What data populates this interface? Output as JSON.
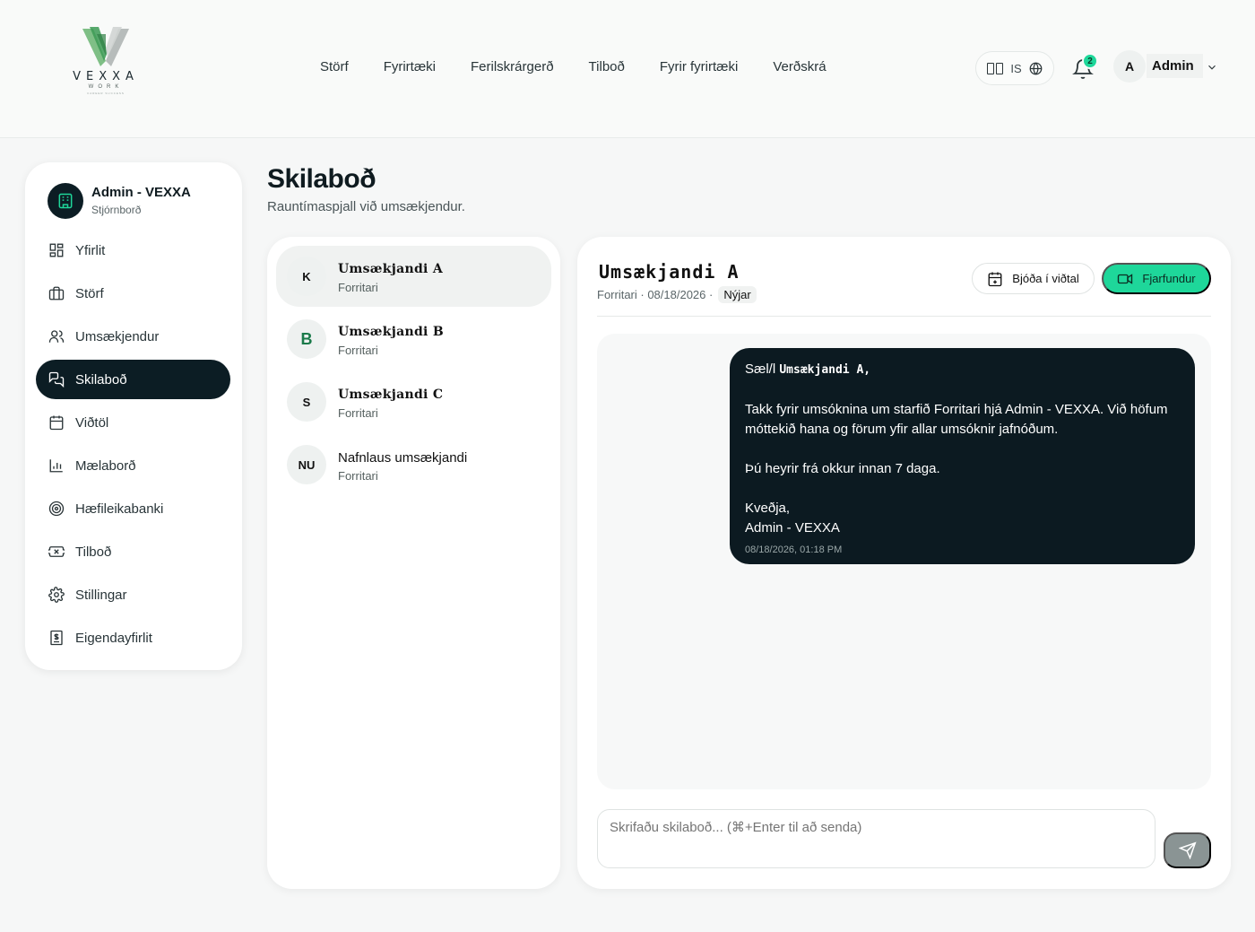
{
  "logo": {
    "brand": "VEXXA",
    "sub": "WORK",
    "tagline": "CAREER SUCCESS"
  },
  "nav": [
    "Störf",
    "Fyrirtæki",
    "Ferilskrárgerð",
    "Tilboð",
    "Fyrir fyrirtæki",
    "Verðskrá"
  ],
  "header": {
    "language": "IS",
    "notification_count": "2",
    "user_initial": "A",
    "user_name": "Admin"
  },
  "sidebar": {
    "title": "Admin - VEXXA",
    "subtitle": "Stjórnborð",
    "items": [
      {
        "label": "Yfirlit",
        "icon": "grid-icon"
      },
      {
        "label": "Störf",
        "icon": "briefcase-icon"
      },
      {
        "label": "Umsækjendur",
        "icon": "users-icon"
      },
      {
        "label": "Skilaboð",
        "icon": "messages-icon",
        "active": true
      },
      {
        "label": "Viðtöl",
        "icon": "calendar-icon"
      },
      {
        "label": "Mælaborð",
        "icon": "chart-icon"
      },
      {
        "label": "Hæfileikabanki",
        "icon": "target-icon"
      },
      {
        "label": "Tilboð",
        "icon": "ticket-icon"
      },
      {
        "label": "Stillingar",
        "icon": "gear-icon"
      },
      {
        "label": "Eigendayfirlit",
        "icon": "receipt-icon"
      }
    ]
  },
  "page": {
    "title": "Skilaboð",
    "subtitle": "Rauntímaspjall við umsækjendur."
  },
  "conversations": [
    {
      "initials": "K",
      "name": "Umsækjandi A",
      "role": "Forritari"
    },
    {
      "initials": "B",
      "name": "Umsækjandi B",
      "role": "Forritari"
    },
    {
      "initials": "S",
      "name": "Umsækjandi C",
      "role": "Forritari"
    },
    {
      "initials": "NU",
      "name": "Nafnlaus umsækjandi",
      "role": "Forritari"
    }
  ],
  "chat": {
    "name": "Umsækjandi A",
    "meta": "Forritari · 08/18/2026 ·",
    "status": "Nýjar",
    "invite_label": "Bjóða í viðtal",
    "remote_label": "Fjarfundur",
    "message": {
      "greeting_prefix": "Sæl/l",
      "greeting_name": "Umsækjandi A,",
      "body": "Takk fyrir umsóknina um starfið Forritari hjá Admin - VEXXA. Við höfum móttekið hana og förum yfir allar umsóknir jafnóðum.",
      "followup": "Þú heyrir frá okkur innan 7 daga.",
      "signoff": "Kveðja,",
      "signature": "Admin - VEXXA",
      "timestamp": "08/18/2026, 01:18 PM"
    },
    "composer_placeholder": "Skrifaðu skilaboð... (⌘+Enter til að senda)"
  },
  "colors": {
    "accent": "#1ed79a",
    "dark": "#0c1a21",
    "send_disabled": "#8a9494"
  }
}
